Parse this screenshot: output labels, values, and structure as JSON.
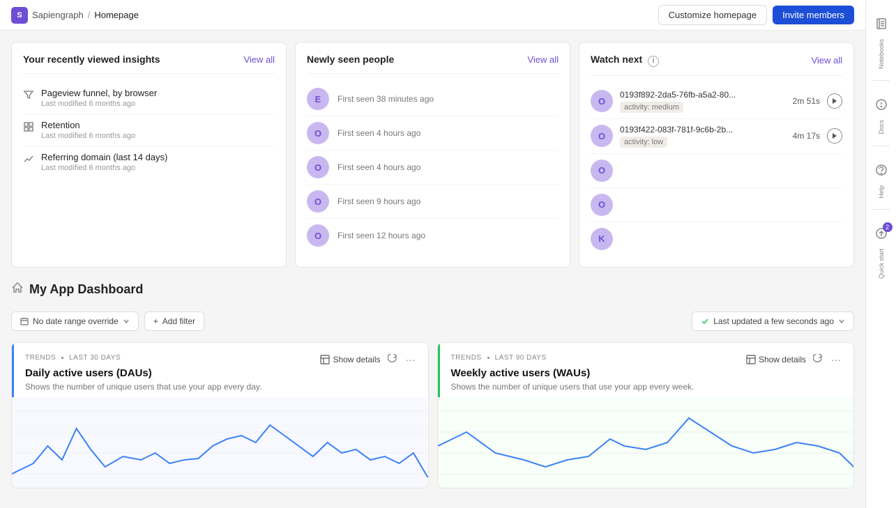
{
  "topbar": {
    "logo_text": "S",
    "brand": "Sapiengraph",
    "separator": "/",
    "page": "Homepage",
    "customize_btn": "Customize homepage",
    "invite_btn": "Invite members"
  },
  "recently_viewed": {
    "title": "Your recently viewed insights",
    "view_all": "View all",
    "items": [
      {
        "name": "Pageview funnel, by browser",
        "modified": "Last modified 6 months ago",
        "icon": "funnel"
      },
      {
        "name": "Retention",
        "modified": "Last modified 6 months ago",
        "icon": "retention"
      },
      {
        "name": "Referring domain (last 14 days)",
        "modified": "Last modified 6 months ago",
        "icon": "trend"
      }
    ]
  },
  "newly_seen": {
    "title": "Newly seen people",
    "view_all": "View all",
    "items": [
      {
        "initial": "E",
        "time": "First seen 38 minutes ago"
      },
      {
        "initial": "O",
        "time": "First seen 4 hours ago"
      },
      {
        "initial": "O",
        "time": "First seen 4 hours ago"
      },
      {
        "initial": "O",
        "time": "First seen 9 hours ago"
      },
      {
        "initial": "O",
        "time": "First seen 12 hours ago"
      }
    ]
  },
  "watch_next": {
    "title": "Watch next",
    "view_all": "View all",
    "items": [
      {
        "id": "0193f892-2da5-76fb-a5a2-80...",
        "badge": "activity: medium",
        "time": "2m 51s",
        "has_play": true,
        "initial": "O"
      },
      {
        "id": "0193f422-083f-781f-9c6b-2b...",
        "badge": "activity: low",
        "time": "4m 17s",
        "has_play": true,
        "initial": "O"
      },
      {
        "initial": "O",
        "id": "",
        "badge": "",
        "time": "",
        "has_play": false
      },
      {
        "initial": "O",
        "id": "",
        "badge": "",
        "time": "",
        "has_play": false
      },
      {
        "initial": "K",
        "id": "",
        "badge": "",
        "time": "",
        "has_play": false
      }
    ]
  },
  "dashboard": {
    "title": "My App Dashboard",
    "filter_date": "No date range override",
    "filter_add": "Add filter",
    "last_updated": "Last updated a few seconds ago"
  },
  "chart1": {
    "meta_label": "TRENDS",
    "meta_period": "LAST 30 DAYS",
    "title": "Daily active users (DAUs)",
    "description": "Shows the number of unique users that use your app every day.",
    "show_details": "Show details",
    "accent_color": "#3b82f6"
  },
  "chart2": {
    "meta_label": "TRENDS",
    "meta_period": "LAST 90 DAYS",
    "title": "Weekly active users (WAUs)",
    "description": "Shows the number of unique users that use your app every week.",
    "show_details": "Show details",
    "accent_color": "#22c55e"
  },
  "sidebar": {
    "notebooks_label": "Notebooks",
    "docs_label": "Docs",
    "help_label": "Help",
    "quickstart_label": "Quick start",
    "quickstart_count": "2"
  }
}
